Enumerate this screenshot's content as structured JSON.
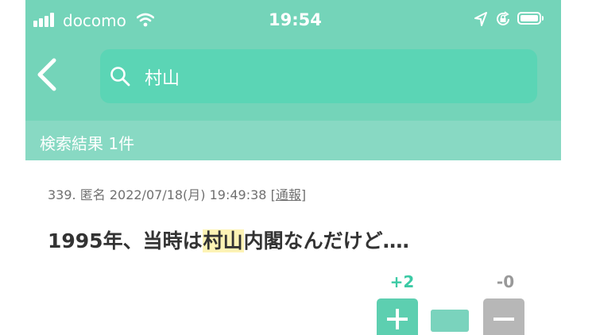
{
  "status_bar": {
    "carrier": "docomo",
    "time": "19:54",
    "icons": [
      "signal-icon",
      "wifi-icon",
      "location-icon",
      "orientation-lock-icon",
      "battery-icon"
    ]
  },
  "nav": {
    "back_icon": "chevron-left-icon",
    "search": {
      "icon": "search-icon",
      "value": "村山",
      "placeholder": ""
    }
  },
  "results": {
    "label": "検索結果 1件"
  },
  "post": {
    "number": "339.",
    "author": "匿名",
    "datetime": "2022/07/18(月) 19:49:38",
    "report_label": "通報",
    "body_before": "1995年、当時は",
    "body_highlight": "村山",
    "body_after": "内閣なんだけど‥‥",
    "plus_count": "+2",
    "minus_count": "-0",
    "approval_ratio": 1.0
  },
  "colors": {
    "header": "#74d4b9",
    "search_box": "#5bd5b5",
    "results_bar": "#88d9c3",
    "plus": "#5dcfb0",
    "minus": "#b7b7b7",
    "highlight": "#fdf3b5"
  }
}
